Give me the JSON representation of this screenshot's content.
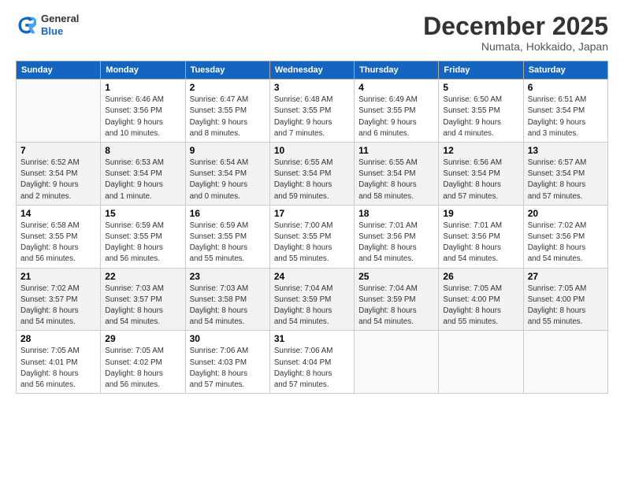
{
  "logo": {
    "line1": "General",
    "line2": "Blue"
  },
  "title": "December 2025",
  "subtitle": "Numata, Hokkaido, Japan",
  "weekdays": [
    "Sunday",
    "Monday",
    "Tuesday",
    "Wednesday",
    "Thursday",
    "Friday",
    "Saturday"
  ],
  "weeks": [
    [
      {
        "day": "",
        "detail": ""
      },
      {
        "day": "1",
        "detail": "Sunrise: 6:46 AM\nSunset: 3:56 PM\nDaylight: 9 hours\nand 10 minutes."
      },
      {
        "day": "2",
        "detail": "Sunrise: 6:47 AM\nSunset: 3:55 PM\nDaylight: 9 hours\nand 8 minutes."
      },
      {
        "day": "3",
        "detail": "Sunrise: 6:48 AM\nSunset: 3:55 PM\nDaylight: 9 hours\nand 7 minutes."
      },
      {
        "day": "4",
        "detail": "Sunrise: 6:49 AM\nSunset: 3:55 PM\nDaylight: 9 hours\nand 6 minutes."
      },
      {
        "day": "5",
        "detail": "Sunrise: 6:50 AM\nSunset: 3:55 PM\nDaylight: 9 hours\nand 4 minutes."
      },
      {
        "day": "6",
        "detail": "Sunrise: 6:51 AM\nSunset: 3:54 PM\nDaylight: 9 hours\nand 3 minutes."
      }
    ],
    [
      {
        "day": "7",
        "detail": "Sunrise: 6:52 AM\nSunset: 3:54 PM\nDaylight: 9 hours\nand 2 minutes."
      },
      {
        "day": "8",
        "detail": "Sunrise: 6:53 AM\nSunset: 3:54 PM\nDaylight: 9 hours\nand 1 minute."
      },
      {
        "day": "9",
        "detail": "Sunrise: 6:54 AM\nSunset: 3:54 PM\nDaylight: 9 hours\nand 0 minutes."
      },
      {
        "day": "10",
        "detail": "Sunrise: 6:55 AM\nSunset: 3:54 PM\nDaylight: 8 hours\nand 59 minutes."
      },
      {
        "day": "11",
        "detail": "Sunrise: 6:55 AM\nSunset: 3:54 PM\nDaylight: 8 hours\nand 58 minutes."
      },
      {
        "day": "12",
        "detail": "Sunrise: 6:56 AM\nSunset: 3:54 PM\nDaylight: 8 hours\nand 57 minutes."
      },
      {
        "day": "13",
        "detail": "Sunrise: 6:57 AM\nSunset: 3:54 PM\nDaylight: 8 hours\nand 57 minutes."
      }
    ],
    [
      {
        "day": "14",
        "detail": "Sunrise: 6:58 AM\nSunset: 3:55 PM\nDaylight: 8 hours\nand 56 minutes."
      },
      {
        "day": "15",
        "detail": "Sunrise: 6:59 AM\nSunset: 3:55 PM\nDaylight: 8 hours\nand 56 minutes."
      },
      {
        "day": "16",
        "detail": "Sunrise: 6:59 AM\nSunset: 3:55 PM\nDaylight: 8 hours\nand 55 minutes."
      },
      {
        "day": "17",
        "detail": "Sunrise: 7:00 AM\nSunset: 3:55 PM\nDaylight: 8 hours\nand 55 minutes."
      },
      {
        "day": "18",
        "detail": "Sunrise: 7:01 AM\nSunset: 3:56 PM\nDaylight: 8 hours\nand 54 minutes."
      },
      {
        "day": "19",
        "detail": "Sunrise: 7:01 AM\nSunset: 3:56 PM\nDaylight: 8 hours\nand 54 minutes."
      },
      {
        "day": "20",
        "detail": "Sunrise: 7:02 AM\nSunset: 3:56 PM\nDaylight: 8 hours\nand 54 minutes."
      }
    ],
    [
      {
        "day": "21",
        "detail": "Sunrise: 7:02 AM\nSunset: 3:57 PM\nDaylight: 8 hours\nand 54 minutes."
      },
      {
        "day": "22",
        "detail": "Sunrise: 7:03 AM\nSunset: 3:57 PM\nDaylight: 8 hours\nand 54 minutes."
      },
      {
        "day": "23",
        "detail": "Sunrise: 7:03 AM\nSunset: 3:58 PM\nDaylight: 8 hours\nand 54 minutes."
      },
      {
        "day": "24",
        "detail": "Sunrise: 7:04 AM\nSunset: 3:59 PM\nDaylight: 8 hours\nand 54 minutes."
      },
      {
        "day": "25",
        "detail": "Sunrise: 7:04 AM\nSunset: 3:59 PM\nDaylight: 8 hours\nand 54 minutes."
      },
      {
        "day": "26",
        "detail": "Sunrise: 7:05 AM\nSunset: 4:00 PM\nDaylight: 8 hours\nand 55 minutes."
      },
      {
        "day": "27",
        "detail": "Sunrise: 7:05 AM\nSunset: 4:00 PM\nDaylight: 8 hours\nand 55 minutes."
      }
    ],
    [
      {
        "day": "28",
        "detail": "Sunrise: 7:05 AM\nSunset: 4:01 PM\nDaylight: 8 hours\nand 56 minutes."
      },
      {
        "day": "29",
        "detail": "Sunrise: 7:05 AM\nSunset: 4:02 PM\nDaylight: 8 hours\nand 56 minutes."
      },
      {
        "day": "30",
        "detail": "Sunrise: 7:06 AM\nSunset: 4:03 PM\nDaylight: 8 hours\nand 57 minutes."
      },
      {
        "day": "31",
        "detail": "Sunrise: 7:06 AM\nSunset: 4:04 PM\nDaylight: 8 hours\nand 57 minutes."
      },
      {
        "day": "",
        "detail": ""
      },
      {
        "day": "",
        "detail": ""
      },
      {
        "day": "",
        "detail": ""
      }
    ]
  ]
}
